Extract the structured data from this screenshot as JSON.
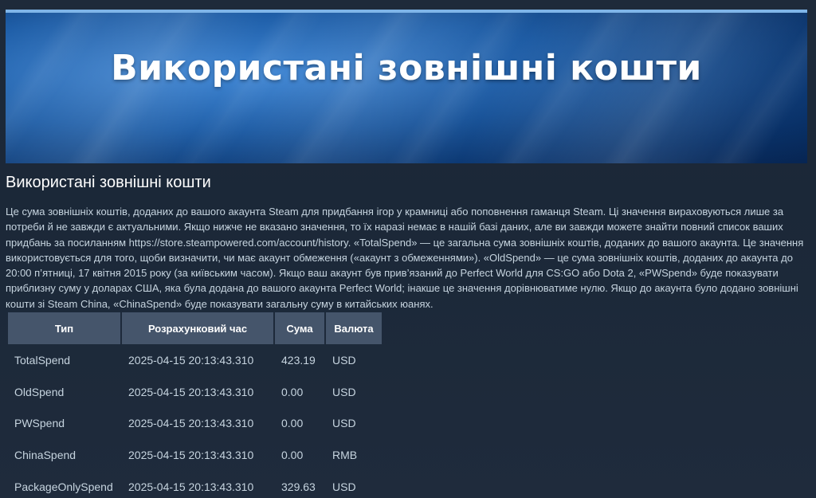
{
  "banner": {
    "title": "Використані зовнішні кошти"
  },
  "section": {
    "title": "Використані зовнішні кошти",
    "description": "Це сума зовнішніх коштів, доданих до вашого акаунта Steam для придбання ігор у крамниці або поповнення гаманця Steam. Ці значення вираховуються лише за потреби й не завжди є актуальними. Якщо нижче не вказано значення, то їх наразі немає в нашій базі даних, але ви завжди можете знайти повний список ваших придбань за посиланням https://store.steampowered.com/account/history. «TotalSpend» — це загальна сума зовнішніх коштів, доданих до вашого акаунта. Це значення використовується для того, щоби визначити, чи має акаунт обмеження («акаунт з обмеженнями»). «OldSpend» — це сума зовнішніх коштів, доданих до акаунта до 20:00 п’ятниці, 17 квітня 2015 року (за київським часом). Якщо ваш акаунт був прив’язаний до Perfect World для CS:GO або Dota 2, «PWSpend» буде показувати приблизну суму у доларах США, яка була додана до вашого акаунта Perfect World; інакше це значення дорівнюватиме нулю. Якщо до акаунта було додано зовнішні кошти зі Steam China, «ChinaSpend» буде показувати загальну суму в китайських юанях."
  },
  "table": {
    "headers": {
      "type": "Тип",
      "time": "Розрахунковий час",
      "sum": "Сума",
      "currency": "Валюта"
    },
    "rows": [
      {
        "type": "TotalSpend",
        "time": "2025-04-15 20:13:43.310",
        "sum": "423.19",
        "currency": "USD"
      },
      {
        "type": "OldSpend",
        "time": "2025-04-15 20:13:43.310",
        "sum": "0.00",
        "currency": "USD"
      },
      {
        "type": "PWSpend",
        "time": "2025-04-15 20:13:43.310",
        "sum": "0.00",
        "currency": "USD"
      },
      {
        "type": "ChinaSpend",
        "time": "2025-04-15 20:13:43.310",
        "sum": "0.00",
        "currency": "RMB"
      },
      {
        "type": "PackageOnlySpend",
        "time": "2025-04-15 20:13:43.310",
        "sum": "329.63",
        "currency": "USD"
      }
    ]
  },
  "colors": {
    "background": "#1b2838",
    "text": "#c6d4df",
    "header_bg": "#45556b",
    "banner_accent": "#7fb5e8"
  }
}
